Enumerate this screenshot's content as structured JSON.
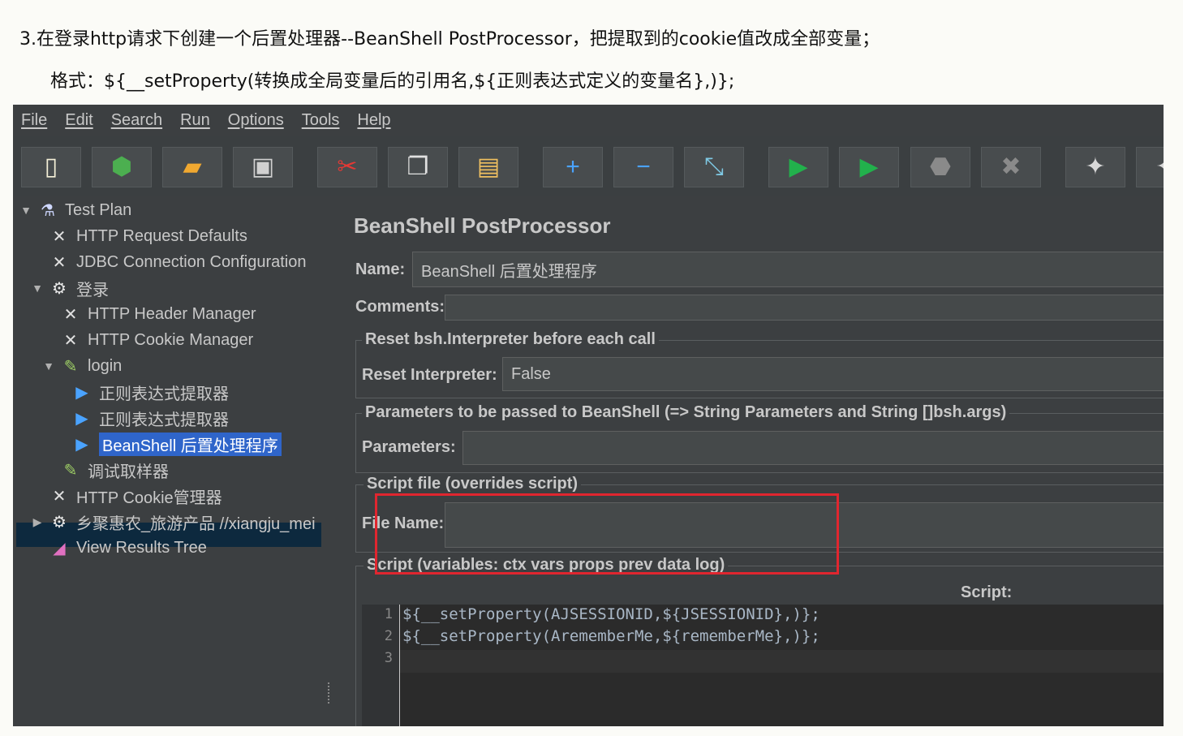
{
  "doc": {
    "line1": "3.在登录http请求下创建一个后置处理器--BeanShell PostProcessor，把提取到的cookie值改成全部变量；",
    "line2": "格式：${__setProperty(转换成全局变量后的引用名,${正则表达式定义的变量名},)};"
  },
  "menu": [
    "File",
    "Edit",
    "Search",
    "Run",
    "Options",
    "Tools",
    "Help"
  ],
  "toolbar": {
    "buttons": [
      {
        "name": "new-icon",
        "glyph": "▯",
        "color": "#f5f0d8"
      },
      {
        "name": "templates-icon",
        "glyph": "⬢",
        "color": "#4caf50"
      },
      {
        "name": "open-icon",
        "glyph": "▰",
        "color": "#f0a830"
      },
      {
        "name": "save-icon",
        "glyph": "▣",
        "color": "#d0d0d0"
      },
      {
        "name": "cut-icon",
        "glyph": "✂",
        "color": "#e53935"
      },
      {
        "name": "copy-icon",
        "glyph": "❐",
        "color": "#e0e0e0"
      },
      {
        "name": "paste-icon",
        "glyph": "▤",
        "color": "#f0c060"
      },
      {
        "name": "expand-icon",
        "glyph": "+",
        "color": "#4aa3ff"
      },
      {
        "name": "collapse-icon",
        "glyph": "−",
        "color": "#4aa3ff"
      },
      {
        "name": "toggle-icon",
        "glyph": "⤡",
        "color": "#7ec8e3"
      },
      {
        "name": "start-icon",
        "glyph": "▶",
        "color": "#22b14c"
      },
      {
        "name": "start-no-pauses-icon",
        "glyph": "▶",
        "color": "#22b14c"
      },
      {
        "name": "stop-icon",
        "glyph": "⬣",
        "color": "#8a8a8a"
      },
      {
        "name": "shutdown-icon",
        "glyph": "✖",
        "color": "#8a8a8a"
      },
      {
        "name": "clear-icon",
        "glyph": "✦",
        "color": "#d8d8d8"
      },
      {
        "name": "clear-all-icon",
        "glyph": "✦",
        "color": "#d8d8d8"
      }
    ]
  },
  "tree": {
    "nodes": [
      {
        "label": "Test Plan",
        "indent": 0,
        "toggle": "▼",
        "icon": "flask-icon",
        "glyph": "⚗",
        "color": "#cfd8ff"
      },
      {
        "label": "HTTP Request Defaults",
        "indent": 1,
        "toggle": "",
        "icon": "config-tools-icon",
        "glyph": "✕",
        "color": "#e0e0e0"
      },
      {
        "label": "JDBC Connection Configuration",
        "indent": 1,
        "toggle": "",
        "icon": "config-tools-icon",
        "glyph": "✕",
        "color": "#e0e0e0"
      },
      {
        "label": "登录",
        "indent": 1,
        "toggle": "▼",
        "icon": "thread-group-gear-icon",
        "glyph": "⚙",
        "color": "#e8e8e8"
      },
      {
        "label": "HTTP Header Manager",
        "indent": 2,
        "toggle": "",
        "icon": "config-tools-icon",
        "glyph": "✕",
        "color": "#e0e0e0"
      },
      {
        "label": "HTTP Cookie Manager",
        "indent": 2,
        "toggle": "",
        "icon": "config-tools-icon",
        "glyph": "✕",
        "color": "#e0e0e0"
      },
      {
        "label": "login",
        "indent": 2,
        "toggle": "▼",
        "icon": "sampler-pen-icon",
        "glyph": "✎",
        "color": "#9ccc65"
      },
      {
        "label": "正则表达式提取器",
        "indent": 3,
        "toggle": "",
        "icon": "post-processor-icon",
        "glyph": "▶",
        "color": "#4aa3ff"
      },
      {
        "label": "正则表达式提取器",
        "indent": 3,
        "toggle": "",
        "icon": "post-processor-icon",
        "glyph": "▶",
        "color": "#4aa3ff"
      },
      {
        "label": "BeanShell 后置处理程序",
        "indent": 3,
        "toggle": "",
        "icon": "post-processor-icon",
        "glyph": "▶",
        "color": "#4aa3ff",
        "selected": true
      },
      {
        "label": "调试取样器",
        "indent": 2,
        "toggle": "",
        "icon": "sampler-pen-icon",
        "glyph": "✎",
        "color": "#9ccc65"
      },
      {
        "label": "HTTP Cookie管理器",
        "indent": 1,
        "toggle": "",
        "icon": "config-tools-icon",
        "glyph": "✕",
        "color": "#e0e0e0"
      },
      {
        "label": "乡聚惠农_旅游产品 //xiangju_mei",
        "indent": 1,
        "toggle": "▶",
        "icon": "thread-group-gear-icon",
        "glyph": "⚙",
        "color": "#e8e8e8"
      },
      {
        "label": "View Results Tree",
        "indent": 1,
        "toggle": "",
        "icon": "listener-chart-icon",
        "glyph": "◢",
        "color": "#e070c0"
      }
    ]
  },
  "panel": {
    "title": "BeanShell PostProcessor",
    "name_label": "Name:",
    "name_value": "BeanShell 后置处理程序",
    "comments_label": "Comments:",
    "comments_value": "",
    "reset_group_title": "Reset bsh.Interpreter before each call",
    "reset_label": "Reset Interpreter:",
    "reset_value": "False",
    "params_group_title": "Parameters to be passed to BeanShell (=> String Parameters and String []bsh.args)",
    "params_label": "Parameters:",
    "params_value": "",
    "file_group_title": "Script file (overrides script)",
    "file_label": "File Name:",
    "file_value": "",
    "script_group_title": "Script (variables: ctx vars props prev data log)",
    "script_label": "Script:",
    "script_lines": [
      "${__setProperty(AJSESSIONID,${JSESSIONID},)};",
      "${__setProperty(ArememberMe,${rememberMe},)};",
      ""
    ],
    "line_numbers": [
      "1",
      "2",
      "3"
    ],
    "highlight_color": "#e0262f"
  }
}
